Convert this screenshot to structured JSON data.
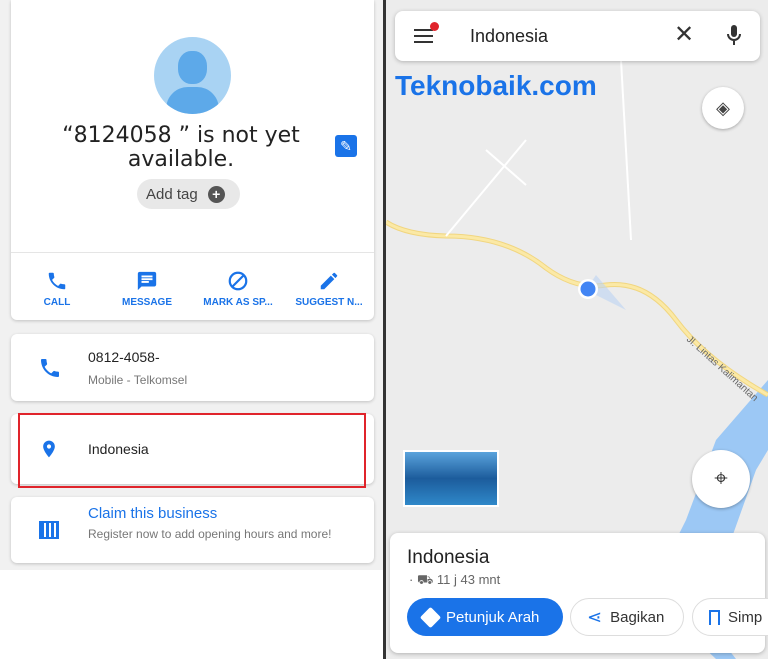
{
  "contact": {
    "title": "“8124058          ” is not yet available.",
    "add_tag": "Add tag"
  },
  "actions": [
    {
      "label": "CALL",
      "icon": "phone-icon"
    },
    {
      "label": "MESSAGE",
      "icon": "message-icon"
    },
    {
      "label": "MARK AS SP...",
      "icon": "block-icon"
    },
    {
      "label": "SUGGEST N...",
      "icon": "pencil-icon"
    }
  ],
  "phone": {
    "number": "0812-4058-",
    "type": "Mobile - Telkomsel"
  },
  "location": {
    "label": "Indonesia"
  },
  "business": {
    "title": "Claim this business",
    "subtitle": "Register now to add opening hours and more!"
  },
  "map": {
    "search_value": "Indonesia",
    "watermark": "Teknobaik.com",
    "road_label": "Jl. Lintas Kalimantan",
    "place": {
      "name": "Indonesia",
      "travel": "· ⛟ 11 j 43 mnt",
      "directions": "Petunjuk Arah",
      "share": "Bagikan",
      "save": "Simp"
    }
  },
  "colors": {
    "accent": "#1a73e8",
    "highlight": "#e0242b"
  }
}
